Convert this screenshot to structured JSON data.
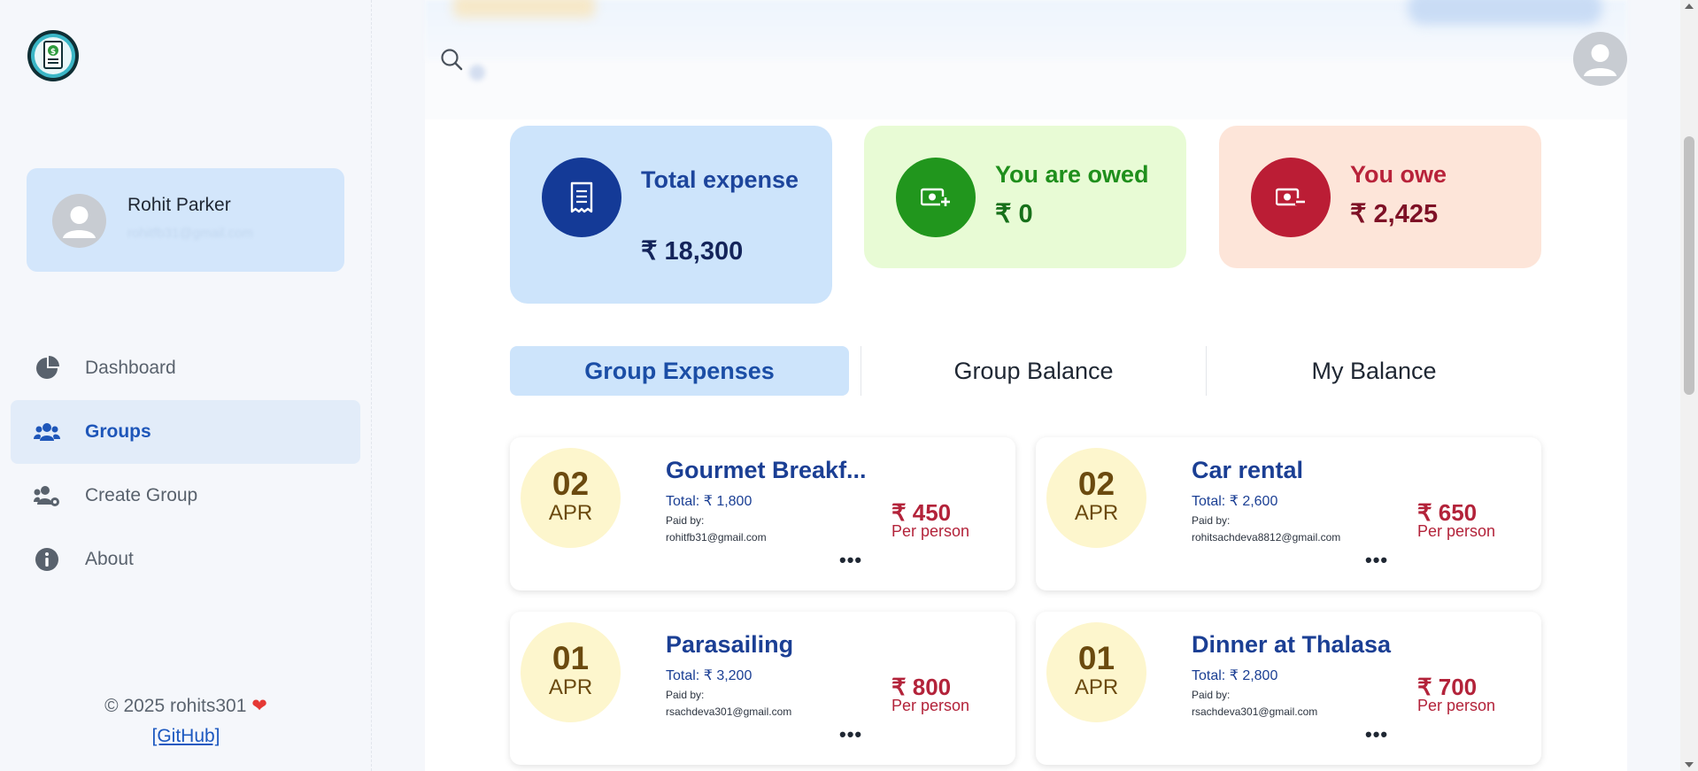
{
  "sidebar": {
    "logo_icon": "receipt-dollar-logo",
    "user": {
      "name": "Rohit Parker",
      "email": "rohitfb31@gmail.com"
    },
    "nav": [
      {
        "label": "Dashboard",
        "icon": "pie-chart-icon",
        "active": false
      },
      {
        "label": "Groups",
        "icon": "users-icon",
        "active": true
      },
      {
        "label": "Create Group",
        "icon": "users-gear-icon",
        "active": false
      },
      {
        "label": "About",
        "icon": "info-icon",
        "active": false
      }
    ],
    "footer": {
      "copyright": "© 2025 rohits301",
      "github": "[GitHub]"
    }
  },
  "header": {
    "search_icon": "search-icon",
    "avatar_icon": "user-avatar-icon"
  },
  "stats": {
    "total": {
      "label": "Total expense",
      "amount": "₹ 18,300",
      "icon": "receipt-icon"
    },
    "owed": {
      "label": "You are owed",
      "amount": "₹ 0",
      "icon": "money-plus-icon"
    },
    "owe": {
      "label": "You owe",
      "amount": "₹ 2,425",
      "icon": "money-minus-icon"
    }
  },
  "tabs": [
    {
      "label": "Group Expenses",
      "active": true
    },
    {
      "label": "Group Balance",
      "active": false
    },
    {
      "label": "My Balance",
      "active": false
    }
  ],
  "expenses": [
    {
      "day": "02",
      "month": "APR",
      "title": "Gourmet Breakf...",
      "total": "Total: ₹ 1,800",
      "paid_label": "Paid by:",
      "paid_by": "rohitfb31@gmail.com",
      "per_person_amount": "₹ 450",
      "per_person_label": "Per person"
    },
    {
      "day": "02",
      "month": "APR",
      "title": "Car rental",
      "total": "Total: ₹ 2,600",
      "paid_label": "Paid by:",
      "paid_by": "rohitsachdeva8812@gmail.com",
      "per_person_amount": "₹ 650",
      "per_person_label": "Per person"
    },
    {
      "day": "01",
      "month": "APR",
      "title": "Parasailing",
      "total": "Total: ₹ 3,200",
      "paid_label": "Paid by:",
      "paid_by": "rsachdeva301@gmail.com",
      "per_person_amount": "₹ 800",
      "per_person_label": "Per person"
    },
    {
      "day": "01",
      "month": "APR",
      "title": "Dinner at Thalasa",
      "total": "Total: ₹ 2,800",
      "paid_label": "Paid by:",
      "paid_by": "rsachdeva301@gmail.com",
      "per_person_amount": "₹ 700",
      "per_person_label": "Per person"
    }
  ],
  "more_label": "•••",
  "colors": {
    "primary": "#1e56b9",
    "owed": "#21961d",
    "owe": "#bb1d35",
    "date_bg": "#fdf6cd"
  }
}
